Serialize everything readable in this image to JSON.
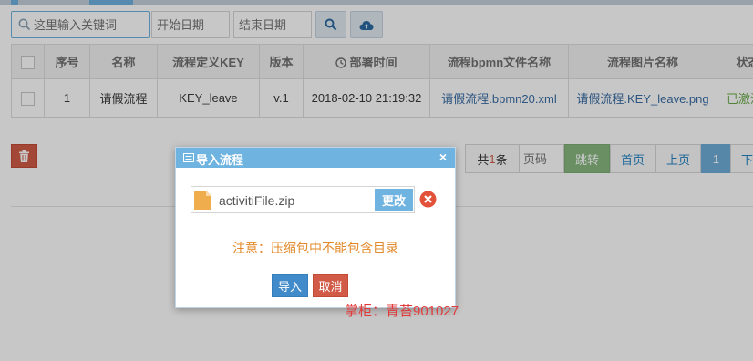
{
  "toolbar": {
    "search_placeholder": "这里输入关键词",
    "start_date_placeholder": "开始日期",
    "end_date_placeholder": "结束日期",
    "search_icon": "search-icon",
    "upload_icon": "cloud-upload-icon"
  },
  "table": {
    "headers": [
      "",
      "序号",
      "名称",
      "流程定义KEY",
      "版本",
      "部署时间",
      "流程bpmn文件名称",
      "流程图片名称",
      "状态"
    ],
    "rows": [
      [
        "",
        "1",
        "请假流程",
        "KEY_leave",
        "v.1",
        "2018-02-10 21:19:32",
        "请假流程.bpmn20.xml",
        "请假流程.KEY_leave.png",
        "已激活"
      ]
    ]
  },
  "pagination": {
    "total_prefix": "共",
    "total_count": "1",
    "total_suffix": "条",
    "page_placeholder": "页码",
    "go_label": "跳转",
    "first_label": "首页",
    "prev_label": "上页",
    "current_page": "1",
    "next_label": "下页"
  },
  "dialog": {
    "title": "导入流程",
    "file_name": "activitiFile.zip",
    "change_label": "更改",
    "notice": "注意：压缩包中不能包含目录",
    "import_label": "导入",
    "cancel_label": "取消",
    "close_glyph": "×"
  },
  "watermark": "掌柜：青苔901027",
  "colors": {
    "accent": "#6fb3e0",
    "danger": "#d15b47",
    "success": "#87b87f",
    "notice": "#e28a2b",
    "primary": "#428bca"
  }
}
